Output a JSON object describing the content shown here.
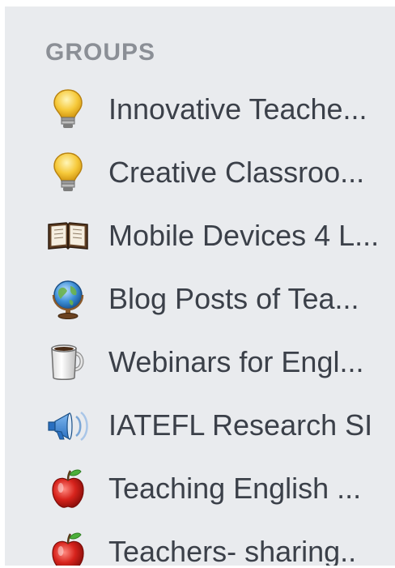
{
  "sidebar": {
    "heading": "GROUPS",
    "groups": [
      {
        "label": "Innovative Teache...",
        "icon": "lightbulb-icon"
      },
      {
        "label": "Creative Classroo...",
        "icon": "lightbulb-icon"
      },
      {
        "label": "Mobile Devices 4 L...",
        "icon": "book-icon"
      },
      {
        "label": "Blog Posts of Tea...",
        "icon": "globe-icon"
      },
      {
        "label": "Webinars for Engl...",
        "icon": "mug-icon"
      },
      {
        "label": "IATEFL Research SI",
        "icon": "megaphone-icon"
      },
      {
        "label": "Teaching English ...",
        "icon": "apple-icon"
      },
      {
        "label": "Teachers- sharing..",
        "icon": "apple-icon"
      }
    ]
  }
}
